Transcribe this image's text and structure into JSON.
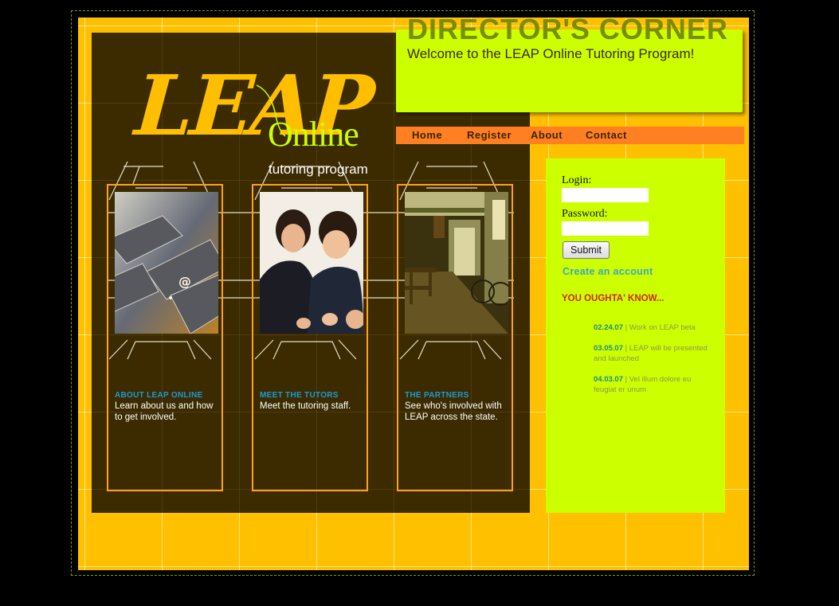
{
  "logo": {
    "leap": "LEAP",
    "online": "Online",
    "sub": "tutoring program"
  },
  "director": {
    "title": "DIRECTOR'S CORNER",
    "welcome": "Welcome to the LEAP Online Tutoring Program!"
  },
  "nav": [
    "Home",
    "Register",
    "About",
    "Contact"
  ],
  "columns": [
    {
      "title": "ABOUT LEAP ONLINE",
      "desc": "Learn about us and how to get involved."
    },
    {
      "title": "MEET THE TUTORS",
      "desc": "Meet the tutoring staff."
    },
    {
      "title": "THE PARTNERS",
      "desc": "See who's involved with LEAP across the state."
    }
  ],
  "login": {
    "login_label": "Login:",
    "password_label": "Password:",
    "submit": "Submit",
    "create": "Create an account"
  },
  "news": {
    "heading": "YOU OUGHTA' KNOW...",
    "items": [
      {
        "date": "02.24.07",
        "text": " | Work on LEAP beta"
      },
      {
        "date": "03.05.07",
        "text": " | LEAP will be presented and launched"
      },
      {
        "date": "04.03.07",
        "text": " | Vel illum dolore eu feugiat er unum"
      }
    ]
  },
  "colors": {
    "page": "#ffc000",
    "brown": "#3d2b00",
    "lime": "#ccff00",
    "orange_nav": "#ff7f22",
    "accent_blue": "#1a9ad6",
    "news_red": "#d0281e"
  }
}
